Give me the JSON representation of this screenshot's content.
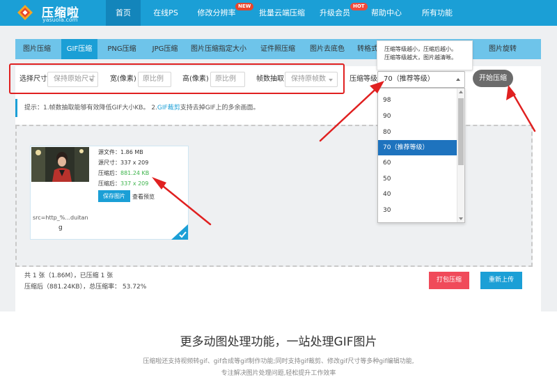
{
  "logo": {
    "name": "压缩啦",
    "domain": "yasuola.com"
  },
  "nav": {
    "items": [
      "首页",
      "在线PS",
      "修改分辨率",
      "批量云端压缩",
      "升级会员",
      "帮助中心",
      "所有功能"
    ],
    "badges": {
      "new": "NEW",
      "hot": "HOT"
    }
  },
  "tabs": [
    "图片压缩",
    "GIF压缩",
    "PNG压缩",
    "JPG压缩",
    "图片压缩指定大小",
    "证件照压缩",
    "图片去底色",
    "转格式",
    "图片旋转"
  ],
  "tooltip": {
    "line1": "压缩等级越小，压缩后越小。",
    "line2": "压缩等级越大，图片越清晰。"
  },
  "controls": {
    "size_label": "选择尺寸",
    "size_value": "保持原始尺寸",
    "width_label": "宽(像素)",
    "width_placeholder": "原比例",
    "height_label": "高(像素)",
    "height_placeholder": "原比例",
    "frame_label": "帧数抽取",
    "frame_value": "保持原帧数",
    "level_label": "压缩等级",
    "level_value": "70（推荐等级）",
    "start_button": "开始压缩"
  },
  "dropdown": {
    "options": [
      "98",
      "90",
      "80",
      "70（推荐等级）",
      "60",
      "50",
      "40",
      "30"
    ],
    "selected_index": 3
  },
  "tip": {
    "prefix": "提示：1.帧数抽取能够有效降低GIF大小KB。 2.",
    "link": "GIF裁剪",
    "suffix": "支持去掉GIF上的多余画面。"
  },
  "card": {
    "src_size": "源文件：1.86 MB",
    "src_dim": "源尺寸：337 x 209",
    "out_size_label": "压缩后：",
    "out_size": "881.24 KB",
    "out_dim_label": "压缩后：",
    "out_dim": "337 x 209",
    "save_button": "保存图片",
    "preview": "查看预览",
    "src_url": "src=http_%...duitan",
    "src_ext": "g"
  },
  "stats": {
    "line1": "共 1 张（1.86M），已压缩 1 张",
    "line2": "压缩后（881.24KB），总压缩率： 53.72%"
  },
  "buttons": {
    "pack": "打包压缩",
    "reupload": "重新上传"
  },
  "footer": {
    "title": "更多动图处理功能，一站处理GIF图片",
    "line1": "压缩啦还支持视频转gif、gif合成等gif制作功能;同时支持gif裁剪、修改gif尺寸等多种gif编辑功能,",
    "line2": "专注解决图片处理问题,轻松提升工作效率"
  },
  "colors": {
    "primary": "#1b9fd6",
    "tab_bar": "#6ec4ea",
    "pack": "#f04a5a",
    "annotation": "#e02020",
    "green": "#3bb34a"
  }
}
